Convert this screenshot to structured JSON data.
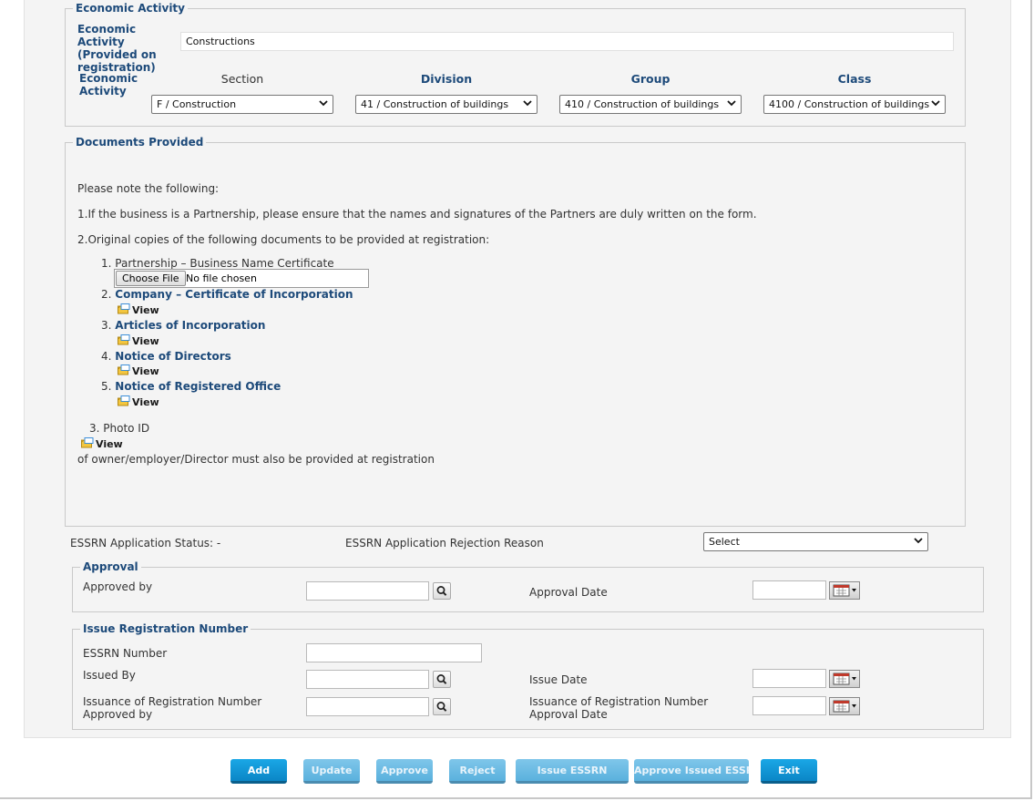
{
  "economic_activity": {
    "legend": "Economic Activity",
    "provided_label": "Economic Activity (Provided on registration)",
    "provided_value": "Constructions",
    "row_label": "Economic Activity",
    "headers": {
      "section": "Section",
      "division": "Division",
      "group": "Group",
      "class": "Class"
    },
    "section_value": "F / Construction",
    "division_value": "41 / Construction of buildings",
    "group_value": "410 / Construction of buildings",
    "class_value": "4100 / Construction of buildings"
  },
  "documents": {
    "legend": "Documents Provided",
    "note": "Please note the following:",
    "item1": "1.If the business is a Partnership, please ensure that the names and signatures of the Partners are duly written on the form.",
    "item2": "2.Original copies of the following documents to be provided at registration:",
    "list": [
      {
        "num": "1.",
        "label": "Partnership – Business Name Certificate"
      },
      {
        "num": "2.",
        "label": "Company – Certificate of Incorporation"
      },
      {
        "num": "3.",
        "label": "Articles of Incorporation"
      },
      {
        "num": "4.",
        "label": "Notice of Directors"
      },
      {
        "num": "5.",
        "label": "Notice of Registered Office"
      }
    ],
    "choose_file": "Choose File",
    "no_file": "No file chosen",
    "view": "View",
    "photo_id": "3. Photo ID",
    "photo_note": "of owner/employer/Director must also be provided at registration"
  },
  "status": {
    "status_label": "ESSRN Application Status: -",
    "rejection_label": "ESSRN Application Rejection Reason",
    "rejection_value": "Select"
  },
  "approval": {
    "legend": "Approval",
    "approved_by": "Approved by",
    "approval_date": "Approval Date"
  },
  "issue": {
    "legend": "Issue Registration Number",
    "essrn_number": "ESSRN Number",
    "issued_by": "Issued By",
    "issue_date": "Issue Date",
    "issuance_approved_by": "Issuance of Registration Number Approved by",
    "issuance_approval_date": "Issuance of Registration Number Approval Date"
  },
  "buttons": {
    "add": "Add",
    "update": "Update",
    "approve": "Approve",
    "reject": "Reject",
    "issue_essrn": "Issue ESSRN",
    "approve_issued": "Approve Issued ESSRN",
    "exit": "Exit"
  },
  "colors": {
    "accent": "#1d4a7a",
    "button": "#0b86c6"
  }
}
